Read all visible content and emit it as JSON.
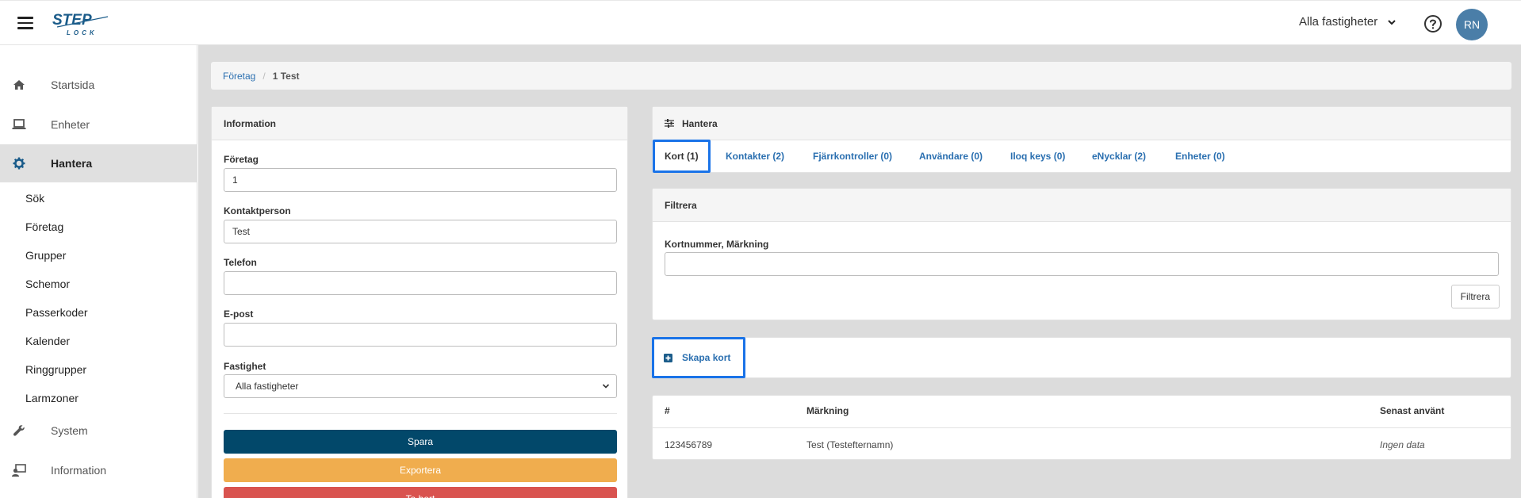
{
  "header": {
    "logo_top": "STEP",
    "logo_bottom": "LOCK",
    "property_select": "Alla fastigheter",
    "avatar_initials": "RN"
  },
  "sidebar": {
    "main": [
      {
        "label": "Startsida",
        "icon": "home-icon"
      },
      {
        "label": "Enheter",
        "icon": "laptop-icon"
      },
      {
        "label": "Hantera",
        "icon": "gear-icon",
        "active": true
      },
      {
        "label": "System",
        "icon": "wrench-icon"
      },
      {
        "label": "Information",
        "icon": "user-screen-icon"
      }
    ],
    "sub": [
      "Sök",
      "Företag",
      "Grupper",
      "Schemor",
      "Passerkoder",
      "Kalender",
      "Ringgrupper",
      "Larmzoner"
    ]
  },
  "breadcrumb": {
    "parent": "Företag",
    "current": "1 Test"
  },
  "info_panel": {
    "title": "Information",
    "company_label": "Företag",
    "company_value": "1",
    "contact_label": "Kontaktperson",
    "contact_value": "Test",
    "phone_label": "Telefon",
    "phone_value": "",
    "email_label": "E-post",
    "email_value": "",
    "property_label": "Fastighet",
    "property_value": "Alla fastigheter",
    "save_label": "Spara",
    "export_label": "Exportera",
    "delete_label": "Ta bort"
  },
  "manage_panel": {
    "title": "Hantera",
    "tabs": [
      "Kort (1)",
      "Kontakter (2)",
      "Fjärrkontroller (0)",
      "Användare (0)",
      "Iloq keys (0)",
      "eNycklar (2)",
      "Enheter (0)"
    ]
  },
  "filter_panel": {
    "title": "Filtrera",
    "search_label": "Kortnummer, Märkning",
    "search_value": "",
    "button_label": "Filtrera"
  },
  "create_card": {
    "label": "Skapa kort"
  },
  "cards_table": {
    "headers": [
      "#",
      "Märkning",
      "Senast använt"
    ],
    "rows": [
      [
        "123456789",
        "Test (Testefternamn)",
        "Ingen data"
      ]
    ]
  },
  "colors": {
    "save": "#02486a",
    "export": "#f0ad4e",
    "delete": "#d9534f",
    "link": "#2a6fb0",
    "highlight": "#1a73e8",
    "avatar": "#4a7ea8"
  }
}
